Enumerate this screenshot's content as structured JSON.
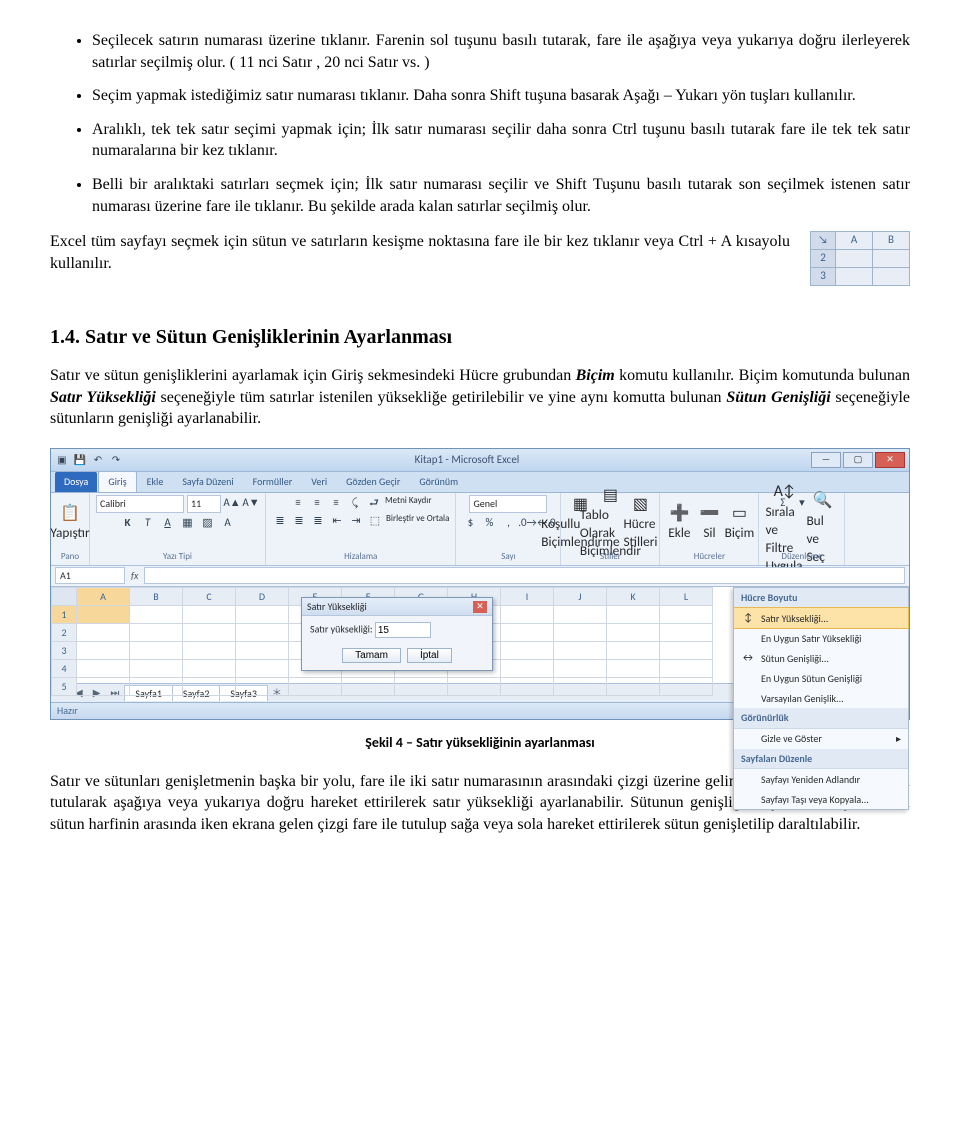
{
  "bullets": [
    "Seçilecek satırın numarası üzerine tıklanır. Farenin sol tuşunu basılı tutarak, fare ile aşağıya veya yukarıya doğru ilerleyerek satırlar seçilmiş olur. ( 11 nci Satır , 20 nci Satır vs. )",
    "Seçim yapmak istediğimiz satır numarası tıklanır. Daha sonra Shift tuşuna basarak Aşağı – Yukarı yön tuşları kullanılır.",
    "Aralıklı, tek tek satır seçimi yapmak için; İlk satır numarası seçilir daha sonra Ctrl tuşunu basılı tutarak fare ile tek tek satır numaralarına bir kez tıklanır.",
    "Belli bir aralıktaki satırları seçmek için; İlk satır numarası seçilir ve Shift Tuşunu basılı tutarak son seçilmek istenen satır numarası üzerine fare ile tıklanır. Bu şekilde arada kalan satırlar seçilmiş olur."
  ],
  "para_after_bullets": "Excel tüm sayfayı seçmek için sütun ve satırların kesişme noktasına fare ile bir kez tıklanır veya   Ctrl + A kısayolu kullanılır.",
  "mini_sheet": {
    "cols": [
      "A",
      "B"
    ],
    "rows": [
      "2",
      "3"
    ]
  },
  "heading": "1.4. Satır ve Sütun Genişliklerinin Ayarlanması",
  "para1_a": "Satır ve sütun genişliklerini ayarlamak için Giriş sekmesindeki Hücre grubundan ",
  "para1_bold1": "Biçim",
  "para1_b": " komutu kullanılır. Biçim komutunda bulunan ",
  "para1_bold2": "Satır Yüksekliği",
  "para1_c": " seçeneğiyle tüm satırlar istenilen yüksekliğe getirilebilir ve yine aynı komutta bulunan ",
  "para1_bold3": "Sütun Genişliği",
  "para1_d": " seçeneğiyle sütunların genişliği ayarlanabilir.",
  "excel": {
    "title": "Kitap1 - Microsoft Excel",
    "tabs": {
      "file": "Dosya",
      "active": "Giriş",
      "others": [
        "Ekle",
        "Sayfa Düzeni",
        "Formüller",
        "Veri",
        "Gözden Geçir",
        "Görünüm"
      ]
    },
    "groups": {
      "pano": {
        "label": "Pano",
        "paste": "Yapıştır"
      },
      "font": {
        "label": "Yazı Tipi",
        "name": "Calibri",
        "size": "11",
        "btns": [
          "K",
          "T",
          "A"
        ]
      },
      "align": {
        "label": "Hizalama",
        "wrap": "Metni Kaydır",
        "merge": "Birleştir ve Ortala"
      },
      "number": {
        "label": "Sayı",
        "sel": "Genel"
      },
      "styles": {
        "label": "Stiller",
        "a": "Koşullu Biçimlendirme",
        "b": "Tablo Olarak Biçimlendir",
        "c": "Hücre Stilleri"
      },
      "cells": {
        "label": "Hücreler",
        "a": "Ekle",
        "b": "Sil",
        "c": "Biçim"
      },
      "edit": {
        "label": "Düzenleme",
        "a": "Sırala ve Filtre Uygula",
        "b": "Bul ve Seç"
      }
    },
    "namebox": "A1",
    "fx": "fx",
    "cols": [
      "A",
      "B",
      "C",
      "D",
      "E",
      "F",
      "G",
      "H",
      "I",
      "J",
      "K",
      "L"
    ],
    "rows": [
      "1",
      "2",
      "3",
      "4",
      "5"
    ],
    "dialog": {
      "title": "Satır Yüksekliği",
      "label": "Satır yüksekliği:",
      "value": "15",
      "ok": "Tamam",
      "cancel": "İptal"
    },
    "menu": {
      "hdr1": "Hücre Boyutu",
      "items1": [
        "Satır Yüksekliği...",
        "En Uygun Satır Yüksekliği",
        "Sütun Genişliği...",
        "En Uygun Sütun Genişliği",
        "Varsayılan Genişlik..."
      ],
      "hdr2": "Görünürlük",
      "items2": [
        "Gizle ve Göster"
      ],
      "hdr3": "Sayfaları Düzenle",
      "items3": [
        "Sayfayı Yeniden Adlandır",
        "Sayfayı Taşı veya Kopyala..."
      ]
    },
    "sheets": [
      "Sayfa1",
      "Sayfa2",
      "Sayfa3"
    ],
    "status": "Hazır"
  },
  "caption": "Şekil 4 – Satır yüksekliğinin ayarlanması",
  "para2": "Satır ve sütunları genişletmenin başka bir yolu, fare ile iki satır numarasının arasındaki çizgi üzerine gelinir ve farenin sol tuşu basılı tutularak aşağıya veya yukarıya doğru hareket ettirilerek satır yüksekliği ayarlanabilir. Sütunun genişliğini ayarlamak için de, iki sütun harfinin arasında iken ekrana gelen çizgi fare ile tutulup sağa veya sola hareket ettirilerek sütun genişletilip daraltılabilir."
}
